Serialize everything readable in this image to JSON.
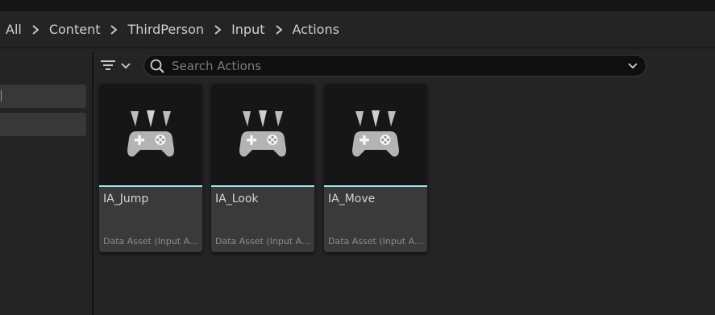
{
  "breadcrumb": {
    "items": [
      "All",
      "Content",
      "ThirdPerson",
      "Input",
      "Actions"
    ]
  },
  "search": {
    "placeholder": "Search Actions",
    "value": ""
  },
  "assets": [
    {
      "name": "IA_Jump",
      "type": "Data Asset (Input Action)",
      "icon": "gamepad-icon"
    },
    {
      "name": "IA_Look",
      "type": "Data Asset (Input Action)",
      "icon": "gamepad-icon"
    },
    {
      "name": "IA_Move",
      "type": "Data Asset (Input Action)",
      "icon": "gamepad-icon"
    }
  ],
  "colors": {
    "background": "#242424",
    "tile": "#3a3a3a",
    "thumbnail": "#161616",
    "accent": "#9de6ef"
  }
}
